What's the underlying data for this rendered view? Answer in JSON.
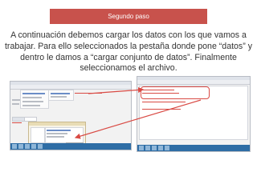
{
  "slide": {
    "banner_title": "Segundo paso",
    "paragraph": "A continuación debemos cargar los datos con los que vamos a trabajar. Para ello seleccionados la pestaña donde pone “datos” y dentro le damos a “cargar conjunto de datos”. Finalmente seleccionamos el archivo."
  },
  "screenshots": [
    {
      "name": "left-screenshot",
      "description_hidden": ""
    },
    {
      "name": "right-screenshot",
      "description_hidden": ""
    }
  ],
  "colors": {
    "banner": "#c8524c",
    "arrow": "#d94a44",
    "text": "#333333",
    "taskbar": "#2e6da5"
  }
}
